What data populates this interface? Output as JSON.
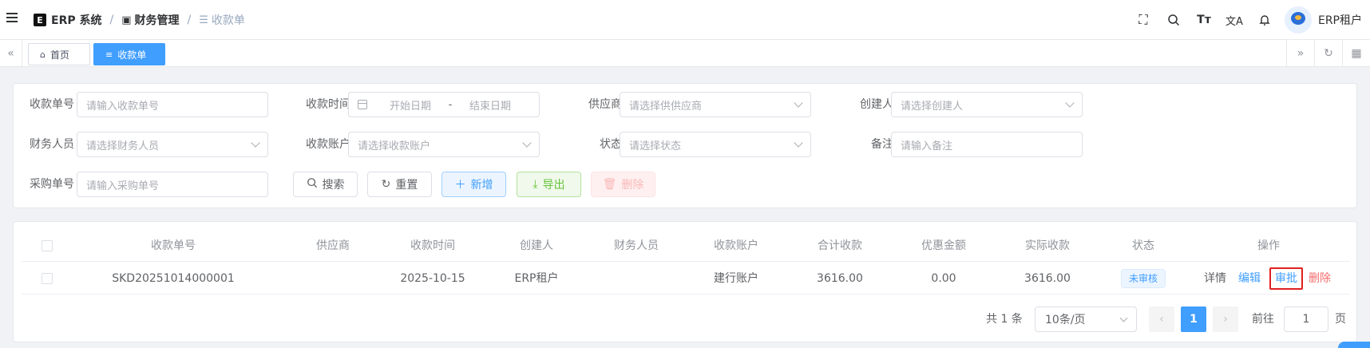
{
  "header": {
    "breadcrumb": {
      "logo_glyph": "E",
      "system": "ERP 系统",
      "module": "财务管理",
      "page": "收款单",
      "separator": "/"
    },
    "user_name": "ERP租户",
    "icons": [
      "fullscreen-icon",
      "search-icon",
      "font-size-icon",
      "translate-icon",
      "bell-icon"
    ]
  },
  "tabs": [
    {
      "label": "首页",
      "icon": "home-icon",
      "active": false
    },
    {
      "label": "收款单",
      "icon": "list-icon",
      "active": true
    }
  ],
  "search": {
    "fields": {
      "receipt_no": {
        "label": "收款单号",
        "placeholder": "请输入收款单号"
      },
      "receipt_time": {
        "label": "收款时间",
        "start_placeholder": "开始日期",
        "separator": "-",
        "end_placeholder": "结束日期"
      },
      "supplier": {
        "label": "供应商",
        "placeholder": "请选择供供应商"
      },
      "creator": {
        "label": "创建人",
        "placeholder": "请选择创建人"
      },
      "finance_user": {
        "label": "财务人员",
        "placeholder": "请选择财务人员"
      },
      "account": {
        "label": "收款账户",
        "placeholder": "请选择收款账户"
      },
      "status": {
        "label": "状态",
        "placeholder": "请选择状态"
      },
      "remark": {
        "label": "备注",
        "placeholder": "请输入备注"
      },
      "purchase_no": {
        "label": "采购单号",
        "placeholder": "请输入采购单号"
      }
    },
    "buttons": {
      "search": "搜索",
      "reset": "重置",
      "add": "新增",
      "export": "导出",
      "delete": "删除"
    }
  },
  "table": {
    "columns": [
      "收款单号",
      "供应商",
      "收款时间",
      "创建人",
      "财务人员",
      "收款账户",
      "合计收款",
      "优惠金额",
      "实际收款",
      "状态",
      "操作"
    ],
    "rows": [
      {
        "receipt_no": "SKD20251014000001",
        "supplier": "",
        "receipt_time": "2025-10-15",
        "creator": "ERP租户",
        "finance_user": "",
        "account": "建行账户",
        "total": "3616.00",
        "discount": "0.00",
        "actual": "3616.00",
        "status": "未审核",
        "actions": {
          "detail": "详情",
          "edit": "编辑",
          "approve": "审批",
          "delete": "删除"
        }
      }
    ]
  },
  "pagination": {
    "total_text": "共 1 条",
    "page_size": "10条/页",
    "current_page": "1",
    "goto_label": "前往",
    "goto_value": "1",
    "page_suffix": "页"
  },
  "colors": {
    "primary": "#409eff",
    "danger": "#f56c6c",
    "success": "#67c23a",
    "highlight_box": "#e02020"
  }
}
